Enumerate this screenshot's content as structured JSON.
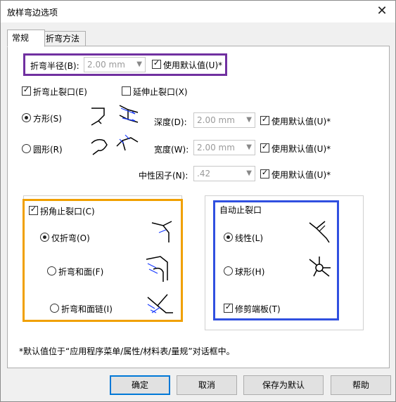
{
  "window": {
    "title": "放样弯边选项",
    "close_glyph": "✕"
  },
  "tabs": [
    {
      "label": "常规"
    },
    {
      "label": "折弯方法"
    }
  ],
  "bend_radius": {
    "label": "折弯半径(B):",
    "value": "2.00 mm",
    "use_default": "使用默认值(U)*"
  },
  "relief": {
    "bend_relief": "折弯止裂口(E)",
    "extend_relief": "延伸止裂口(X)",
    "square": "方形(S)",
    "round": "圆形(R)",
    "depth_label": "深度(D):",
    "depth_value": "2.00 mm",
    "width_label": "宽度(W):",
    "width_value": "2.00 mm",
    "use_default": "使用默认值(U)*"
  },
  "neutral": {
    "label": "中性因子(N):",
    "value": ".42",
    "use_default": "使用默认值(U)*"
  },
  "corner_relief": {
    "label": "拐角止裂口(C)",
    "bend_only": "仅折弯(O)",
    "bend_face": "折弯和面(F)",
    "bend_face_chain": "折弯和面链(I)"
  },
  "auto_relief": {
    "label": "自动止裂口",
    "linear": "线性(L)",
    "spherical": "球形(H)",
    "trim_end": "修剪端板(T)"
  },
  "note": "*默认值位于“应用程序菜单/属性/材料表/量规”对话框中。",
  "buttons": {
    "ok": "确定",
    "cancel": "取消",
    "save_default": "保存为默认",
    "help": "帮助"
  },
  "colors": {
    "purple_highlight": "#7030a0",
    "orange_highlight": "#f0a000",
    "blue_highlight": "#3050e0"
  }
}
